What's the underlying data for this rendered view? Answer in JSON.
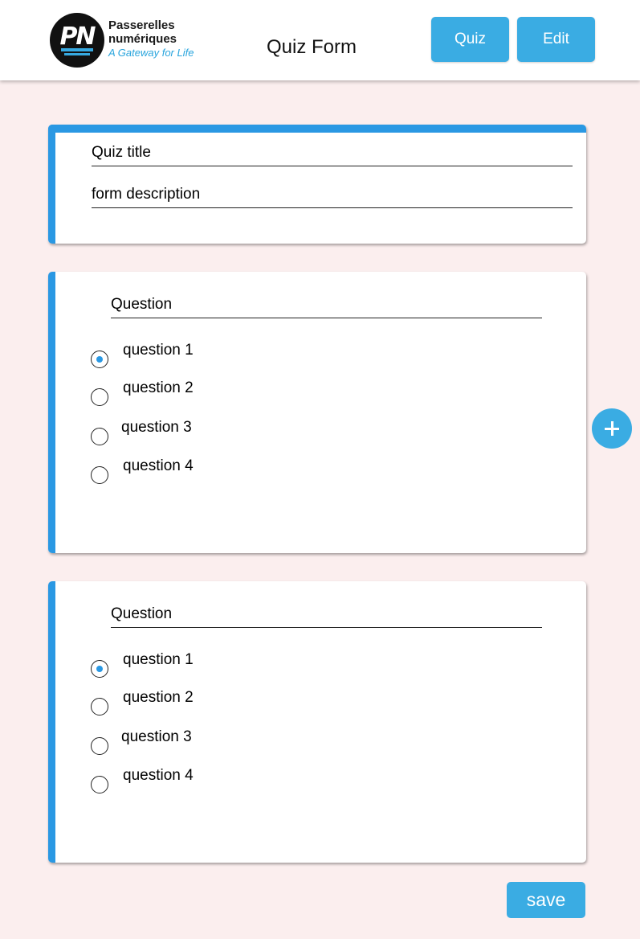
{
  "header": {
    "logo": {
      "initials": "PN",
      "line1": "Passerelles",
      "line2": "numériques",
      "tagline": "A Gateway for Life"
    },
    "title": "Quiz Form",
    "quiz_label": "Quiz",
    "edit_label": "Edit"
  },
  "form": {
    "title_value": "Quiz title",
    "description_value": "form description"
  },
  "questions": [
    {
      "label": "Question",
      "options": [
        {
          "label": "question 1",
          "selected": true
        },
        {
          "label": "question 2",
          "selected": false
        },
        {
          "label": "question 3",
          "selected": false
        },
        {
          "label": "question 4",
          "selected": false
        }
      ]
    },
    {
      "label": "Question",
      "options": [
        {
          "label": "question 1",
          "selected": true
        },
        {
          "label": "question 2",
          "selected": false
        },
        {
          "label": "question 3",
          "selected": false
        },
        {
          "label": "question 4",
          "selected": false
        }
      ]
    }
  ],
  "add_button_icon": "plus-icon",
  "save_label": "save",
  "colors": {
    "accent": "#3aace3",
    "card_bar": "#2a98e3",
    "background": "#fbeeee"
  }
}
